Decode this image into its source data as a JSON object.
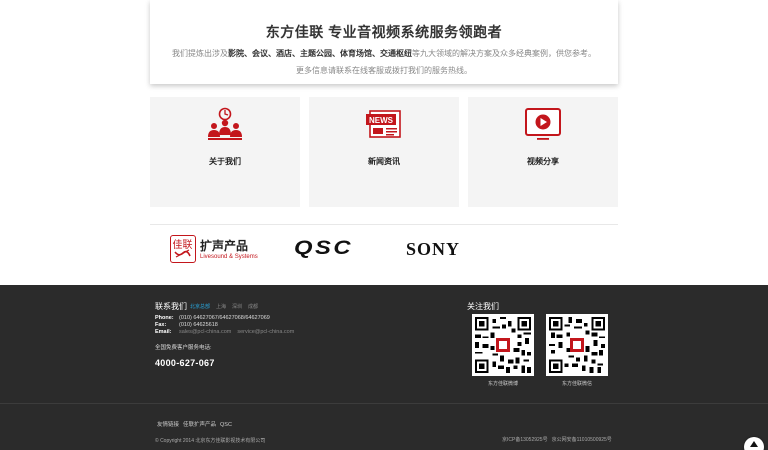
{
  "intro": {
    "title": "东方佳联 专业音视频系统服务领跑者",
    "desc_pre": "我们提炼出涉及",
    "desc_bold": "影院、会议、酒店、主题公园、体育场馆、交通枢纽",
    "desc_post": "等九大领域的解决方案及众多经典案例，供您参考。",
    "desc2": "更多信息请联系在线客服或拨打我们的服务热线。"
  },
  "tiles": [
    {
      "label": "关于我们",
      "icon": "team-icon"
    },
    {
      "label": "新闻资讯",
      "icon": "news-icon"
    },
    {
      "label": "视频分享",
      "icon": "video-play-icon"
    }
  ],
  "colors": {
    "accent": "#c3161c",
    "footer_bg": "#2b2b2b",
    "tile_bg": "#f4f4f4",
    "link_active": "#29a9e0"
  },
  "brands": {
    "jl_seal": "佳联",
    "jl_name": "扩声产品",
    "jl_sub": "Livesound & Systems",
    "qsc": "QSC",
    "sony": "SONY"
  },
  "footer": {
    "contact_title": "联系我们",
    "cities": [
      "北京总部",
      "上海",
      "深圳",
      "成都"
    ],
    "phone_label": "Phone:",
    "phone": "(010) 64627067/64627068/64627069",
    "fax_label": "Fax:",
    "fax": "(010) 64625618",
    "email_label": "Email:",
    "email1": "sales@pcl-china.com",
    "email2": "service@pcl-china.com",
    "hotline_label": "全国免费客户服务电话:",
    "hotline": "4000-627-067",
    "follow_title": "关注我们",
    "qr1_label": "东方佳联微博",
    "qr2_label": "东方佳联微信",
    "links": [
      "友情链接",
      "佳联扩声产品",
      "QSC"
    ],
    "copyright": "© Copyright 2014 北京东方佳联影视技术有限公司",
    "icp": "京ICP备13052925号",
    "police": "京公网安备11010500925号"
  }
}
